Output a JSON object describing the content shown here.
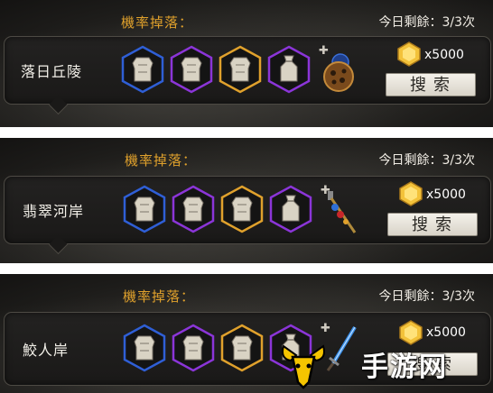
{
  "panels": [
    {
      "drop_label": "機率掉落：",
      "remaining": "今日剩餘：3/3次",
      "location": "落日丘陵",
      "gem_count": "x5000",
      "search_label": "搜索",
      "extra_item_icon": "gear-orb-icon"
    },
    {
      "drop_label": "機率掉落：",
      "remaining": "今日剩餘：3/3次",
      "location": "翡翠河岸",
      "gem_count": "x5000",
      "search_label": "搜索",
      "extra_item_icon": "jeweled-scepter-icon"
    },
    {
      "drop_label": "機率掉落：",
      "remaining": "今日剩餘：3/3次",
      "location": "鮫人岸",
      "gem_count": "x5000",
      "search_label": "搜索",
      "extra_item_icon": "blue-sword-icon"
    }
  ],
  "drop_slots": [
    {
      "rarity": "blue",
      "color": "#2f5fd6",
      "icon": "armor-icon"
    },
    {
      "rarity": "purple",
      "color": "#8b35d8",
      "icon": "armor-icon"
    },
    {
      "rarity": "gold",
      "color": "#e0a12c",
      "icon": "armor-icon"
    },
    {
      "rarity": "purple",
      "color": "#8b35d8",
      "icon": "sack-icon"
    }
  ],
  "watermark": {
    "text": "手游网",
    "icon": "goat-logo-icon"
  },
  "colors": {
    "drop_label": "#e0a12c",
    "gem": "#f3c23a",
    "panel_bg": "#1d1c1a"
  }
}
